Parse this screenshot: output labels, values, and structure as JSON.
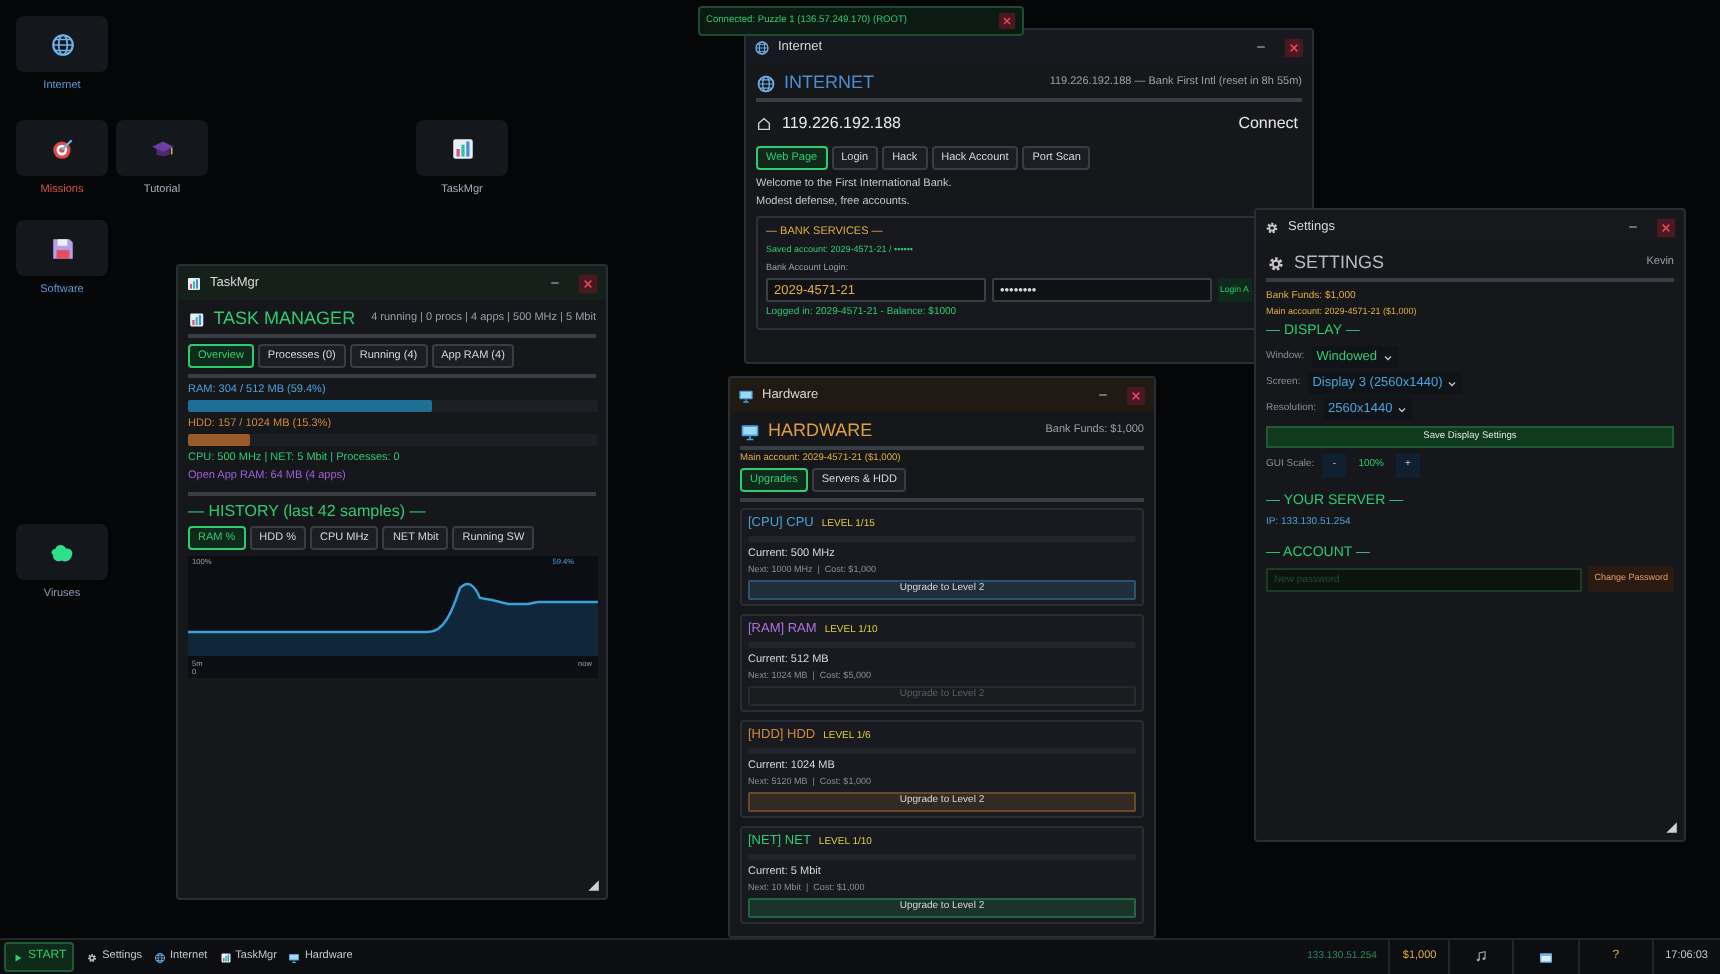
{
  "desktop_icons": [
    {
      "label": "Internet",
      "kind": "globe",
      "color": "#5b9bd5"
    },
    {
      "label": "Missions",
      "kind": "target",
      "color": "#d9534f"
    },
    {
      "label": "Tutorial",
      "kind": "cap",
      "color": "#a9b0bb"
    },
    {
      "label": "TaskMgr",
      "kind": "chart",
      "color": "#a9b0bb"
    },
    {
      "label": "Software",
      "kind": "disk",
      "color": "#5b9bd5"
    },
    {
      "label": "Viruses",
      "kind": "virus",
      "color": "#8a9bb5"
    }
  ],
  "toast": {
    "text": "Connected: Puzzle 1 (136.57.249.170) (ROOT)"
  },
  "internet": {
    "title": "Internet",
    "heading": "INTERNET",
    "status": "119.226.192.188 — Bank First Intl (reset in 8h 55m)",
    "address": "119.226.192.188",
    "connect": "Connect",
    "tabs": [
      {
        "label": "Web Page",
        "selected": true
      },
      {
        "label": "Login",
        "selected": false
      },
      {
        "label": "Hack",
        "selected": false
      },
      {
        "label": "Hack Account",
        "selected": false
      },
      {
        "label": "Port Scan",
        "selected": false
      }
    ],
    "page_lines": [
      "Welcome to the First International Bank.",
      "Modest defense, free accounts."
    ],
    "bank": {
      "title": "— BANK SERVICES —",
      "saved": "Saved account: 2029-4571-21 / ••••••",
      "login_label": "Bank Account Login:",
      "account": "2029-4571-21",
      "password": "••••••••",
      "login_button": "Login A",
      "status": "Logged in: 2029-4571-21 - Balance: $1000"
    }
  },
  "taskmgr": {
    "title": "TaskMgr",
    "heading": "TASK MANAGER",
    "summary": "4 running | 0 procs | 4 apps | 500 MHz | 5 Mbit",
    "tabs": [
      {
        "label": "Overview",
        "selected": true
      },
      {
        "label": "Processes (0)",
        "selected": false
      },
      {
        "label": "Running (4)",
        "selected": false
      },
      {
        "label": "App RAM (4)",
        "selected": false
      }
    ],
    "ram": {
      "label": "RAM: 304 / 512 MB (59.4%)",
      "level": 0.594
    },
    "hdd": {
      "label": "HDD: 157 / 1024 MB (15.3%)",
      "level": 0.153
    },
    "stats": "CPU: 500 MHz | NET: 5 Mbit | Processes: 0",
    "app_ram": "Open App RAM: 64 MB (4 apps)",
    "history_title": "— HISTORY (last 42 samples) —",
    "history_tabs": [
      {
        "label": "RAM %",
        "selected": true
      },
      {
        "label": "HDD %",
        "selected": false
      },
      {
        "label": "CPU MHz",
        "selected": false
      },
      {
        "label": "NET Mbit",
        "selected": false
      },
      {
        "label": "Running SW",
        "selected": false
      }
    ],
    "graph": {
      "top_label": "100%",
      "current": "59.4%",
      "bottom_left": "5m",
      "zero": "0",
      "right": "now"
    }
  },
  "hardware": {
    "title": "Hardware",
    "heading": "HARDWARE",
    "funds": "Bank Funds: $1,000",
    "account": "Main account: 2029-4571-21 ($1,000)",
    "tabs": [
      {
        "label": "Upgrades",
        "selected": true
      },
      {
        "label": "Servers & HDD",
        "selected": false
      }
    ],
    "upgrades": [
      {
        "name": "[CPU] CPU",
        "level_text": "LEVEL 1/15",
        "color": "#4aa3d8",
        "current": "Current: 500 MHz",
        "next": "Next: 1000 MHz  |  Cost: $1,000",
        "button": "Upgrade to Level 2",
        "disabled": false
      },
      {
        "name": "[RAM] RAM",
        "level_text": "LEVEL 1/10",
        "color": "#b070e0",
        "current": "Current: 512 MB",
        "next": "Next: 1024 MB  |  Cost: $5,000",
        "button": "Upgrade to Level 2",
        "disabled": true
      },
      {
        "name": "[HDD] HDD",
        "level_text": "LEVEL 1/6",
        "color": "#d08a3a",
        "current": "Current: 1024 MB",
        "next": "Next: 5120 MB  |  Cost: $1,000",
        "button": "Upgrade to Level 2",
        "disabled": false
      },
      {
        "name": "[NET] NET",
        "level_text": "LEVEL 1/10",
        "color": "#2ecc71",
        "current": "Current: 5 Mbit",
        "next": "Next: 10 Mbit  |  Cost: $1,000",
        "button": "Upgrade to Level 2",
        "disabled": false
      }
    ]
  },
  "settings": {
    "title": "Settings",
    "heading": "SETTINGS",
    "user": "Kevin",
    "funds": "Bank Funds: $1,000",
    "account": "Main account: 2029-4571-21 ($1,000)",
    "display_title": "— DISPLAY —",
    "fields": [
      {
        "label": "Window:",
        "value": "Windowed",
        "color": "#2ecc71"
      },
      {
        "label": "Screen:",
        "value": "Display 3 (2560x1440)",
        "color": "#4aa3d8"
      },
      {
        "label": "Resolution:",
        "value": "2560x1440",
        "color": "#4aa3d8"
      }
    ],
    "save": "Save Display Settings",
    "gui_scale": {
      "label": "GUI Scale:",
      "minus": "-",
      "value": "100%",
      "plus": "+"
    },
    "server_title": "— YOUR SERVER —",
    "ip": "IP: 133.130.51.254",
    "account_title": "— ACCOUNT —",
    "password_placeholder": "New password",
    "change": "Change Password"
  },
  "taskbar": {
    "start": "START",
    "apps": [
      {
        "label": "Settings",
        "kind": "gear"
      },
      {
        "label": "Internet",
        "kind": "globe"
      },
      {
        "label": "TaskMgr",
        "kind": "chart"
      },
      {
        "label": "Hardware",
        "kind": "monitor"
      }
    ],
    "ip": "133.130.51.254",
    "funds": "$1,000",
    "help": "?",
    "clock": "17:06:03"
  }
}
